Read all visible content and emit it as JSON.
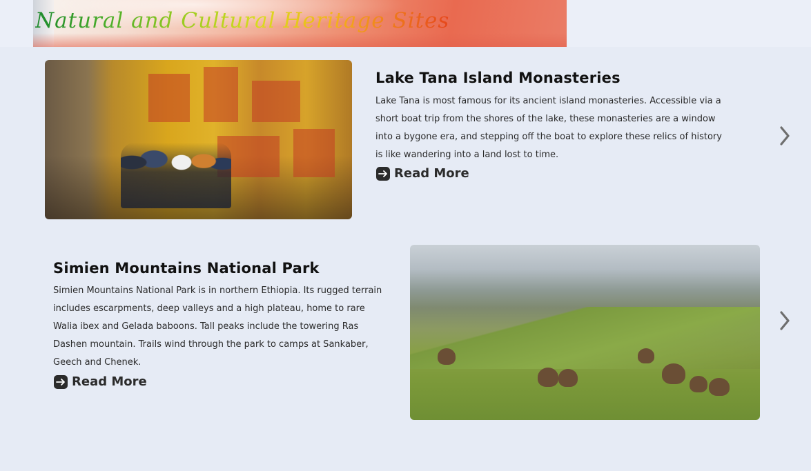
{
  "header": {
    "title": "Natural and Cultural Heritage Sites"
  },
  "sites": [
    {
      "title": "Lake Tana Island Monasteries",
      "description_lines": [
        "Lake Tana is most famous for its ancient island monasteries. Accessible via a",
        "short boat trip from the shores of the lake, these monasteries are a window",
        "into a bygone era, and stepping off the boat to explore these relics of history",
        "is like wandering into a land lost to time."
      ],
      "read_more_label": "Read More",
      "image_icon": "monastery-photo"
    },
    {
      "title": "Simien Mountains National Park",
      "description_lines": [
        "Simien Mountains National Park is in northern Ethiopia. Its rugged terrain",
        "includes escarpments, deep valleys and a high plateau, home to rare",
        "Walia ibex and Gelada baboons. Tall peaks include the towering Ras",
        "Dashen mountain. Trails wind through the park to camps at Sankaber,",
        "Geech and Chenek."
      ],
      "read_more_label": "Read More",
      "image_icon": "mountains-photo"
    }
  ],
  "icons": {
    "read_more": "arrow-right-square-icon",
    "next": "chevron-right-icon"
  },
  "colors": {
    "background": "#e6ebf5",
    "text": "#111111",
    "icon": "#2b2b2b",
    "chevron": "#6e6e6e"
  }
}
